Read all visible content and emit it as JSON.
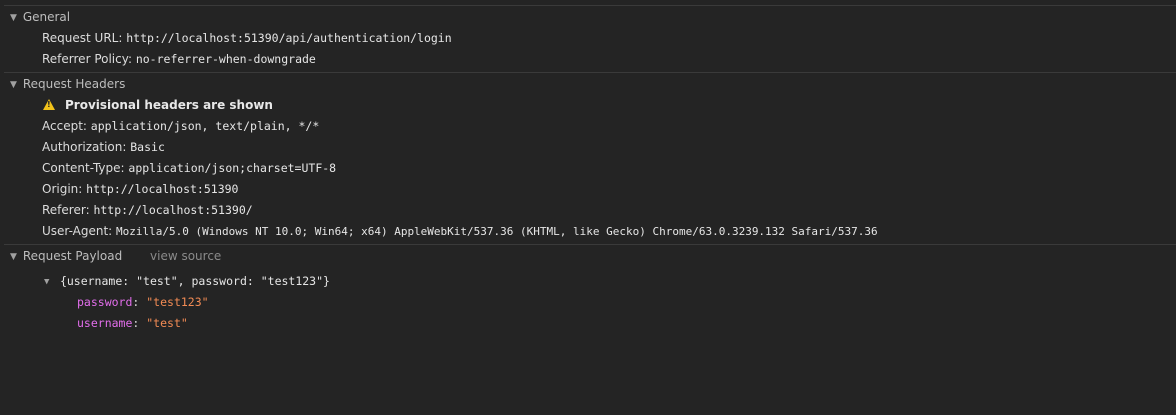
{
  "general": {
    "title": "General",
    "rows": [
      {
        "key": "Request URL:",
        "value": "http://localhost:51390/api/authentication/login"
      },
      {
        "key": "Referrer Policy:",
        "value": "no-referrer-when-downgrade"
      }
    ]
  },
  "request_headers": {
    "title": "Request Headers",
    "warning": "Provisional headers are shown",
    "rows": [
      {
        "key": "Accept:",
        "value": "application/json, text/plain, */*"
      },
      {
        "key": "Authorization:",
        "value": "Basic"
      },
      {
        "key": "Content-Type:",
        "value": "application/json;charset=UTF-8"
      },
      {
        "key": "Origin:",
        "value": "http://localhost:51390"
      },
      {
        "key": "Referer:",
        "value": "http://localhost:51390/"
      },
      {
        "key": "User-Agent:",
        "value": "Mozilla/5.0 (Windows NT 10.0; Win64; x64) AppleWebKit/537.36 (KHTML, like Gecko) Chrome/63.0.3239.132 Safari/537.36"
      }
    ]
  },
  "payload": {
    "title": "Request Payload",
    "view_source": "view source",
    "object_summary": "{username: \"test\", password: \"test123\"}",
    "props": [
      {
        "key": "password",
        "value": "\"test123\""
      },
      {
        "key": "username",
        "value": "\"test\""
      }
    ]
  },
  "icons": {
    "collapse": "triangle-down-icon",
    "warning": "warning-triangle-icon"
  },
  "colors": {
    "background": "#242424",
    "warning": "#f2c21a",
    "prop_key": "#e36eec",
    "string_value": "#f28b54"
  }
}
